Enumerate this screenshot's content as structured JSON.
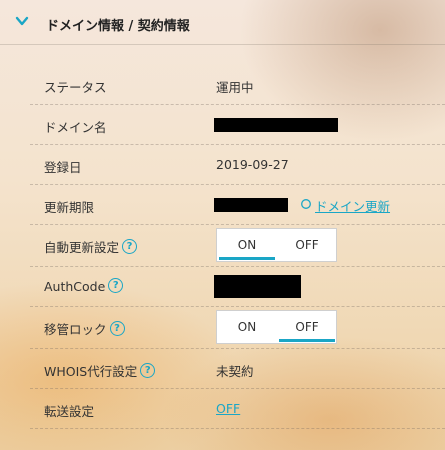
{
  "header": {
    "title": "ドメイン情報 / 契約情報"
  },
  "rows": {
    "status": {
      "label": "ステータス",
      "value": "運用中"
    },
    "domain_name": {
      "label": "ドメイン名"
    },
    "registration_date": {
      "label": "登録日",
      "value": "2019-09-27"
    },
    "expiration": {
      "label": "更新期限",
      "link": "ドメイン更新"
    },
    "auto_renew": {
      "label": "自動更新設定",
      "on": "ON",
      "off": "OFF",
      "selected": "ON"
    },
    "authcode": {
      "label": "AuthCode"
    },
    "transfer_lock": {
      "label": "移管ロック",
      "on": "ON",
      "off": "OFF",
      "selected": "OFF"
    },
    "whois": {
      "label": "WHOIS代行設定",
      "value": "未契約"
    },
    "forwarding": {
      "label": "転送設定",
      "link": "OFF"
    }
  },
  "help_glyph": "?",
  "colors": {
    "accent": "#1aa6c6"
  },
  "icons": [
    "chevron-down-icon",
    "help-icon",
    "refresh-icon"
  ]
}
